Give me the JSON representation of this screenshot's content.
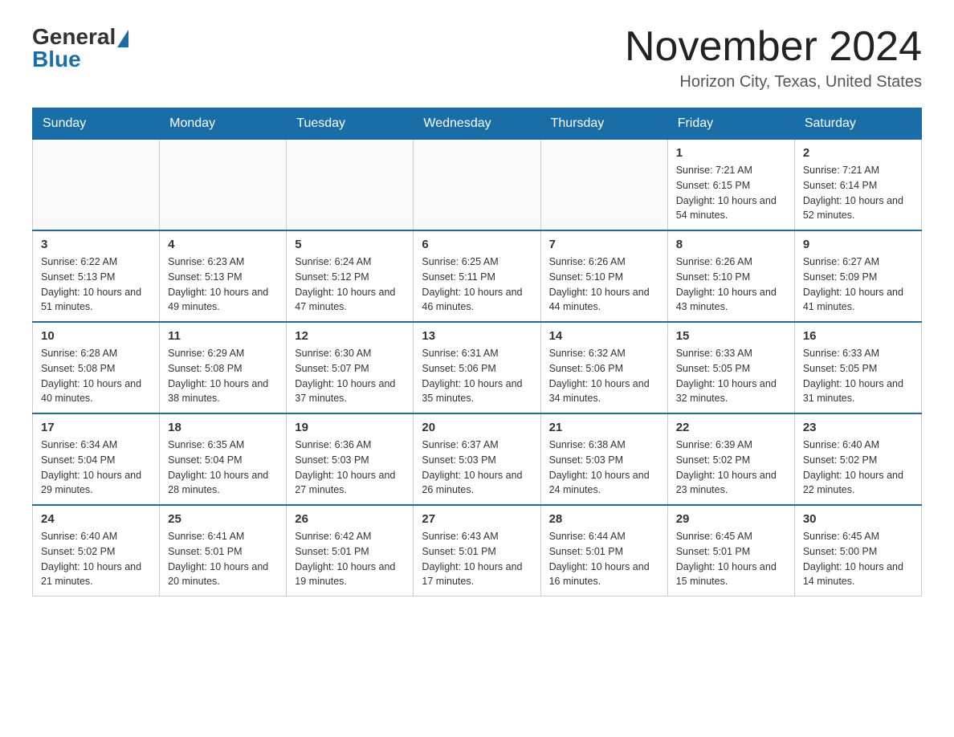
{
  "header": {
    "logo_general": "General",
    "logo_blue": "Blue",
    "month_title": "November 2024",
    "location": "Horizon City, Texas, United States"
  },
  "days_of_week": [
    "Sunday",
    "Monday",
    "Tuesday",
    "Wednesday",
    "Thursday",
    "Friday",
    "Saturday"
  ],
  "weeks": [
    [
      {
        "day": "",
        "info": ""
      },
      {
        "day": "",
        "info": ""
      },
      {
        "day": "",
        "info": ""
      },
      {
        "day": "",
        "info": ""
      },
      {
        "day": "",
        "info": ""
      },
      {
        "day": "1",
        "info": "Sunrise: 7:21 AM\nSunset: 6:15 PM\nDaylight: 10 hours and 54 minutes."
      },
      {
        "day": "2",
        "info": "Sunrise: 7:21 AM\nSunset: 6:14 PM\nDaylight: 10 hours and 52 minutes."
      }
    ],
    [
      {
        "day": "3",
        "info": "Sunrise: 6:22 AM\nSunset: 5:13 PM\nDaylight: 10 hours and 51 minutes."
      },
      {
        "day": "4",
        "info": "Sunrise: 6:23 AM\nSunset: 5:13 PM\nDaylight: 10 hours and 49 minutes."
      },
      {
        "day": "5",
        "info": "Sunrise: 6:24 AM\nSunset: 5:12 PM\nDaylight: 10 hours and 47 minutes."
      },
      {
        "day": "6",
        "info": "Sunrise: 6:25 AM\nSunset: 5:11 PM\nDaylight: 10 hours and 46 minutes."
      },
      {
        "day": "7",
        "info": "Sunrise: 6:26 AM\nSunset: 5:10 PM\nDaylight: 10 hours and 44 minutes."
      },
      {
        "day": "8",
        "info": "Sunrise: 6:26 AM\nSunset: 5:10 PM\nDaylight: 10 hours and 43 minutes."
      },
      {
        "day": "9",
        "info": "Sunrise: 6:27 AM\nSunset: 5:09 PM\nDaylight: 10 hours and 41 minutes."
      }
    ],
    [
      {
        "day": "10",
        "info": "Sunrise: 6:28 AM\nSunset: 5:08 PM\nDaylight: 10 hours and 40 minutes."
      },
      {
        "day": "11",
        "info": "Sunrise: 6:29 AM\nSunset: 5:08 PM\nDaylight: 10 hours and 38 minutes."
      },
      {
        "day": "12",
        "info": "Sunrise: 6:30 AM\nSunset: 5:07 PM\nDaylight: 10 hours and 37 minutes."
      },
      {
        "day": "13",
        "info": "Sunrise: 6:31 AM\nSunset: 5:06 PM\nDaylight: 10 hours and 35 minutes."
      },
      {
        "day": "14",
        "info": "Sunrise: 6:32 AM\nSunset: 5:06 PM\nDaylight: 10 hours and 34 minutes."
      },
      {
        "day": "15",
        "info": "Sunrise: 6:33 AM\nSunset: 5:05 PM\nDaylight: 10 hours and 32 minutes."
      },
      {
        "day": "16",
        "info": "Sunrise: 6:33 AM\nSunset: 5:05 PM\nDaylight: 10 hours and 31 minutes."
      }
    ],
    [
      {
        "day": "17",
        "info": "Sunrise: 6:34 AM\nSunset: 5:04 PM\nDaylight: 10 hours and 29 minutes."
      },
      {
        "day": "18",
        "info": "Sunrise: 6:35 AM\nSunset: 5:04 PM\nDaylight: 10 hours and 28 minutes."
      },
      {
        "day": "19",
        "info": "Sunrise: 6:36 AM\nSunset: 5:03 PM\nDaylight: 10 hours and 27 minutes."
      },
      {
        "day": "20",
        "info": "Sunrise: 6:37 AM\nSunset: 5:03 PM\nDaylight: 10 hours and 26 minutes."
      },
      {
        "day": "21",
        "info": "Sunrise: 6:38 AM\nSunset: 5:03 PM\nDaylight: 10 hours and 24 minutes."
      },
      {
        "day": "22",
        "info": "Sunrise: 6:39 AM\nSunset: 5:02 PM\nDaylight: 10 hours and 23 minutes."
      },
      {
        "day": "23",
        "info": "Sunrise: 6:40 AM\nSunset: 5:02 PM\nDaylight: 10 hours and 22 minutes."
      }
    ],
    [
      {
        "day": "24",
        "info": "Sunrise: 6:40 AM\nSunset: 5:02 PM\nDaylight: 10 hours and 21 minutes."
      },
      {
        "day": "25",
        "info": "Sunrise: 6:41 AM\nSunset: 5:01 PM\nDaylight: 10 hours and 20 minutes."
      },
      {
        "day": "26",
        "info": "Sunrise: 6:42 AM\nSunset: 5:01 PM\nDaylight: 10 hours and 19 minutes."
      },
      {
        "day": "27",
        "info": "Sunrise: 6:43 AM\nSunset: 5:01 PM\nDaylight: 10 hours and 17 minutes."
      },
      {
        "day": "28",
        "info": "Sunrise: 6:44 AM\nSunset: 5:01 PM\nDaylight: 10 hours and 16 minutes."
      },
      {
        "day": "29",
        "info": "Sunrise: 6:45 AM\nSunset: 5:01 PM\nDaylight: 10 hours and 15 minutes."
      },
      {
        "day": "30",
        "info": "Sunrise: 6:45 AM\nSunset: 5:00 PM\nDaylight: 10 hours and 14 minutes."
      }
    ]
  ]
}
